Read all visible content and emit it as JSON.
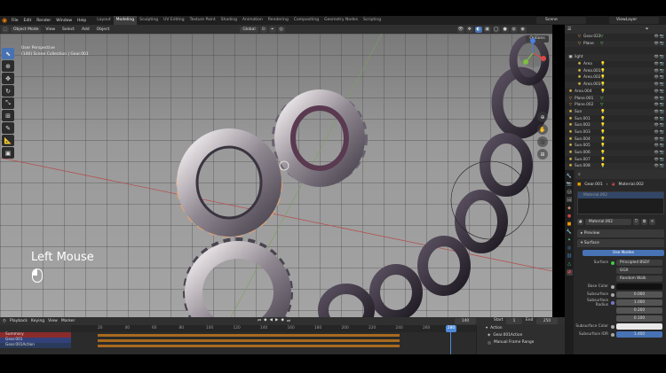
{
  "topbar": {
    "menus": [
      "File",
      "Edit",
      "Render",
      "Window",
      "Help"
    ],
    "workspaces": [
      "Layout",
      "Modeling",
      "Sculpting",
      "UV Editing",
      "Texture Paint",
      "Shading",
      "Animation",
      "Rendering",
      "Compositing",
      "Geometry Nodes",
      "Scripting"
    ],
    "active_workspace": "Modeling",
    "scene": "Scene",
    "view_layer": "ViewLayer"
  },
  "header": {
    "mode": "Object Mode",
    "menus": [
      "View",
      "Select",
      "Add",
      "Object"
    ],
    "orientation": "Global"
  },
  "viewport": {
    "info_line1": "User Perspective",
    "info_line2": "(140) Scene Collection | Gear.001",
    "options": "Options",
    "key_overlay": "Left Mouse"
  },
  "outliner": {
    "rows": [
      {
        "name": "Gear.023",
        "icon": "mesh",
        "indent": 2
      },
      {
        "name": "Plane",
        "icon": "mesh",
        "indent": 2
      },
      {
        "name": "",
        "icon": "",
        "indent": 1
      },
      {
        "name": "light",
        "icon": "collection",
        "indent": 0
      },
      {
        "name": "Area",
        "icon": "light",
        "indent": 2
      },
      {
        "name": "Area.001",
        "icon": "light",
        "indent": 2
      },
      {
        "name": "Area.002",
        "icon": "light",
        "indent": 2
      },
      {
        "name": "Area.003",
        "icon": "light",
        "indent": 2
      },
      {
        "name": "Area.004",
        "icon": "light",
        "indent": 0
      },
      {
        "name": "Plane.001",
        "icon": "mesh",
        "indent": 0
      },
      {
        "name": "Plane.002",
        "icon": "mesh",
        "indent": 0
      },
      {
        "name": "Sun",
        "icon": "light",
        "indent": 0
      },
      {
        "name": "Sun.001",
        "icon": "light",
        "indent": 0
      },
      {
        "name": "Sun.002",
        "icon": "light",
        "indent": 0
      },
      {
        "name": "Sun.003",
        "icon": "light",
        "indent": 0
      },
      {
        "name": "Sun.004",
        "icon": "light",
        "indent": 0
      },
      {
        "name": "Sun.005",
        "icon": "light",
        "indent": 0
      },
      {
        "name": "Sun.006",
        "icon": "light",
        "indent": 0
      },
      {
        "name": "Sun.007",
        "icon": "light",
        "indent": 0
      },
      {
        "name": "Sun.008",
        "icon": "light",
        "indent": 0
      },
      {
        "name": "Sun.009",
        "icon": "light",
        "indent": 0
      }
    ]
  },
  "properties": {
    "breadcrumb_object": "Gear.001",
    "breadcrumb_material": "Material.002",
    "slot": "Material.002",
    "material_field": "Material.002",
    "panel_preview": "Preview",
    "panel_surface": "Surface",
    "use_nodes": "Use Nodes",
    "surface_label": "Surface",
    "surface_value": "Principled BSDF",
    "method_value": "GGX",
    "sss_method_value": "Random Walk",
    "base_color_label": "Base Color",
    "subsurface_label": "Subsurface",
    "subsurface_value": "0.000",
    "subsurface_radius_label": "Subsurface Radius",
    "radius_values": [
      "1.000",
      "0.200",
      "0.100"
    ],
    "subsurface_color_label": "Subsurface Color",
    "subsurface_ior_label": "Subsurface IOR",
    "subsurface_ior_value": "1.400"
  },
  "timeline": {
    "menus": [
      "Playback",
      "Keying",
      "View",
      "Marker"
    ],
    "current_frame": "140",
    "start_label": "Start",
    "start_value": "1",
    "end_label": "End",
    "end_value": "250",
    "ticks": [
      "20",
      "40",
      "60",
      "80",
      "100",
      "120",
      "140",
      "160",
      "180",
      "200",
      "220",
      "240",
      "260"
    ],
    "playhead_label": "280",
    "channels": [
      "Summary",
      "Gear.001",
      "Gear.001Action"
    ],
    "side_title": "Action",
    "side_action": "Gear.001Action",
    "side_manual": "Manual Frame Range"
  }
}
